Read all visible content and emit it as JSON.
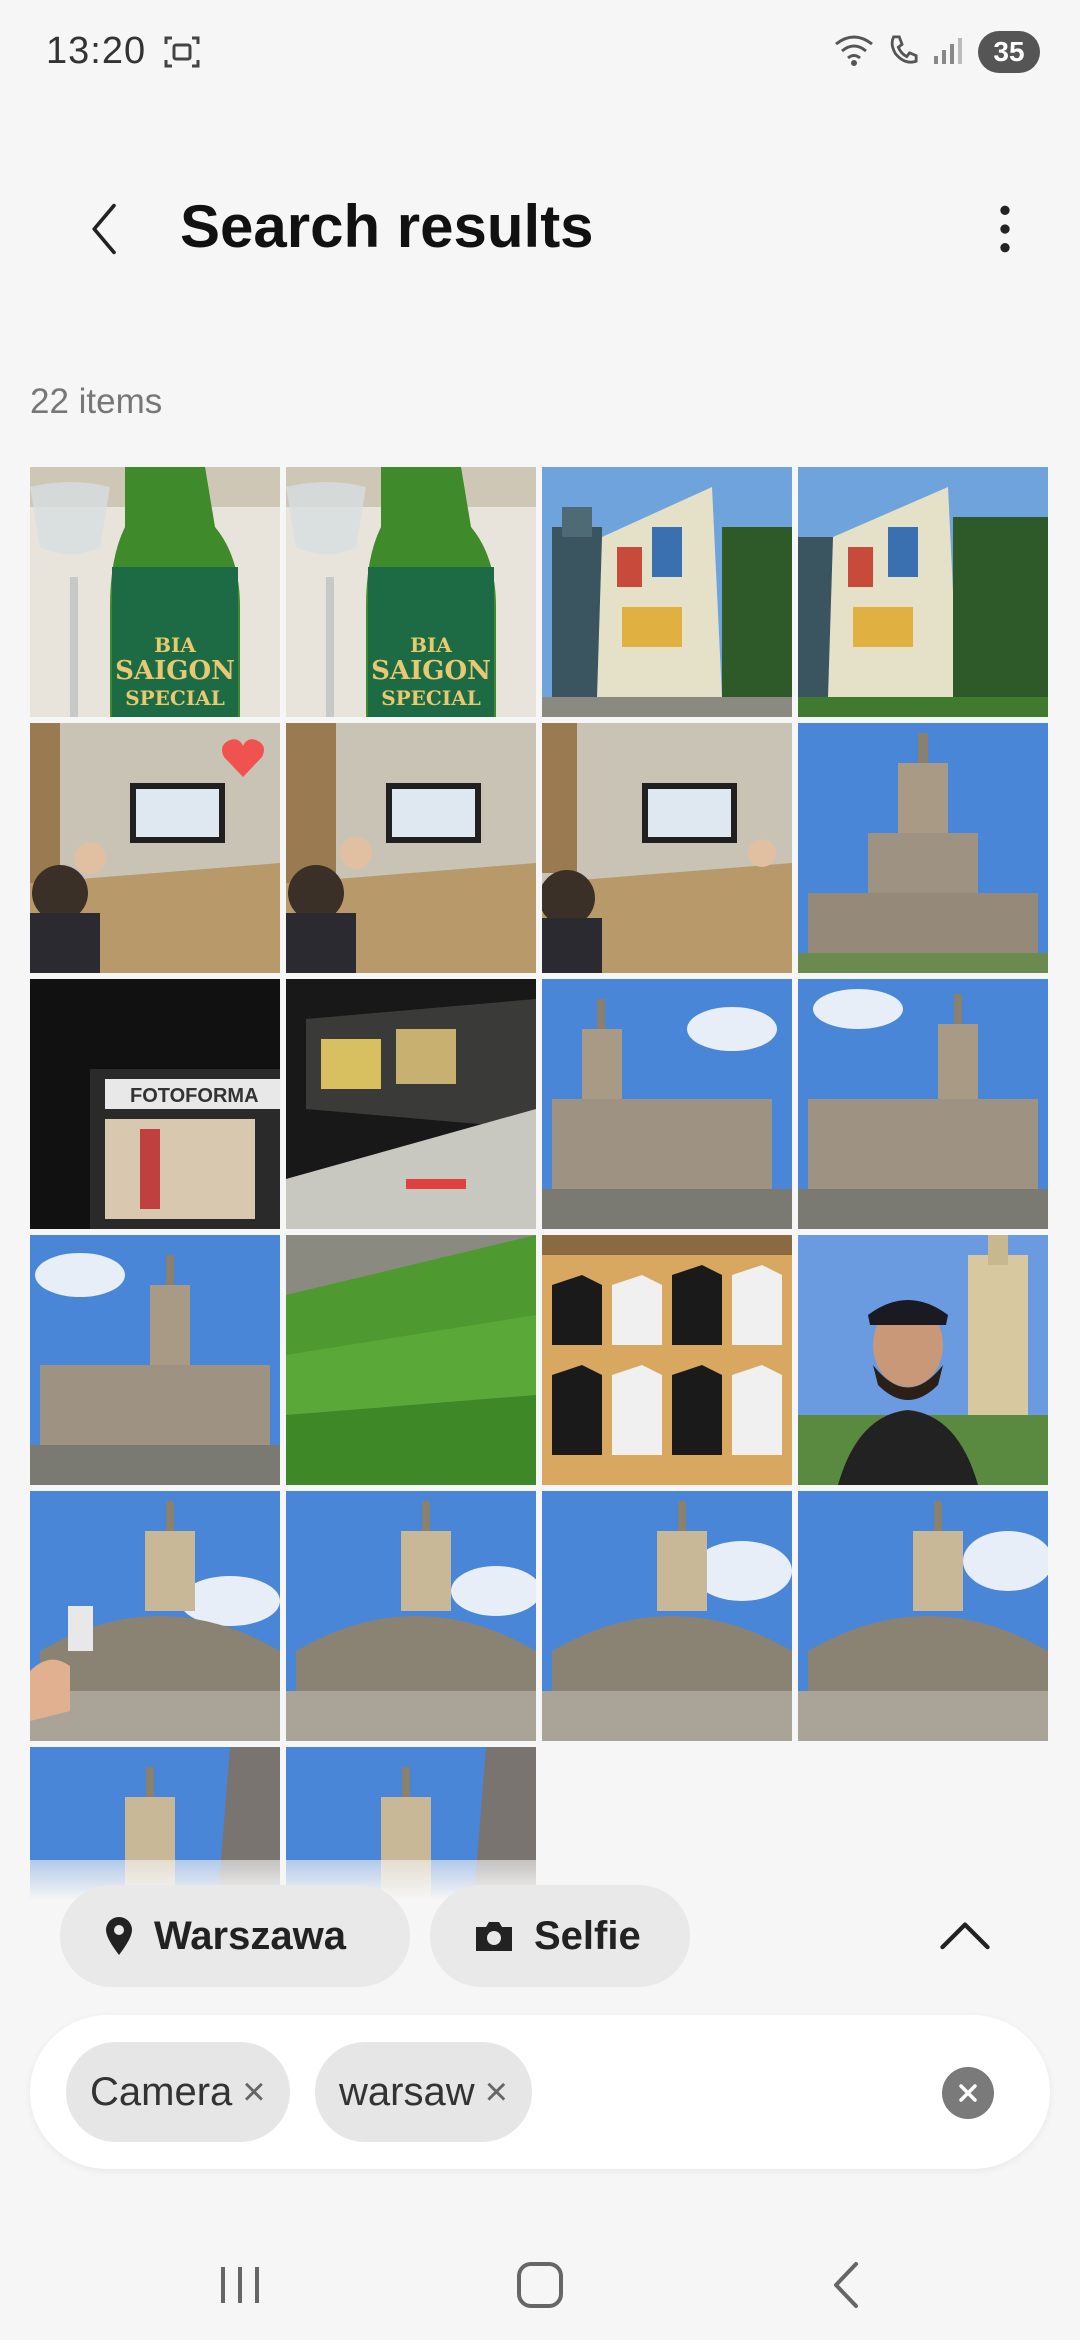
{
  "status_bar": {
    "time": "13:20",
    "battery": "35",
    "icons": [
      "screenshot-icon",
      "wifi-icon",
      "wifi-call-icon",
      "signal-icon"
    ]
  },
  "header": {
    "title": "Search results",
    "back_icon": "chevron-left-icon",
    "more_icon": "more-vertical-icon"
  },
  "results": {
    "count_label": "22 items",
    "thumbnails": [
      {
        "subject": "beer-bottle"
      },
      {
        "subject": "beer-bottle"
      },
      {
        "subject": "mural-building"
      },
      {
        "subject": "mural-building"
      },
      {
        "subject": "meeting-room",
        "favorite": true
      },
      {
        "subject": "meeting-room"
      },
      {
        "subject": "meeting-room"
      },
      {
        "subject": "palace-tower"
      },
      {
        "subject": "shop-window"
      },
      {
        "subject": "metro-train"
      },
      {
        "subject": "palace-wide"
      },
      {
        "subject": "palace-wide"
      },
      {
        "subject": "palace-wide"
      },
      {
        "subject": "grass"
      },
      {
        "subject": "tshirt-shop"
      },
      {
        "subject": "selfie"
      },
      {
        "subject": "palace-square"
      },
      {
        "subject": "palace-square"
      },
      {
        "subject": "palace-square"
      },
      {
        "subject": "palace-square"
      },
      {
        "subject": "palace-partial"
      },
      {
        "subject": "palace-partial"
      }
    ],
    "beer_label": [
      "BIA",
      "SAIGON",
      "SPECIAL"
    ],
    "shop_sign": "FOTOFORMA"
  },
  "suggestions": {
    "location_chip": "Warszawa",
    "selfie_chip": "Selfie",
    "expand_icon": "chevron-up-icon"
  },
  "search": {
    "tags": [
      {
        "label": "Camera"
      },
      {
        "label": "warsaw"
      }
    ],
    "remove_glyph": "×",
    "clear_icon": "clear-circle-icon"
  },
  "nav": {
    "recent_icon": "recent-apps-icon",
    "home_icon": "home-icon",
    "back_icon": "back-icon"
  },
  "colors": {
    "background": "#f6f6f6",
    "chip": "#e9e9e9",
    "heart": "#f0524f",
    "sky": "#4a86d8"
  }
}
